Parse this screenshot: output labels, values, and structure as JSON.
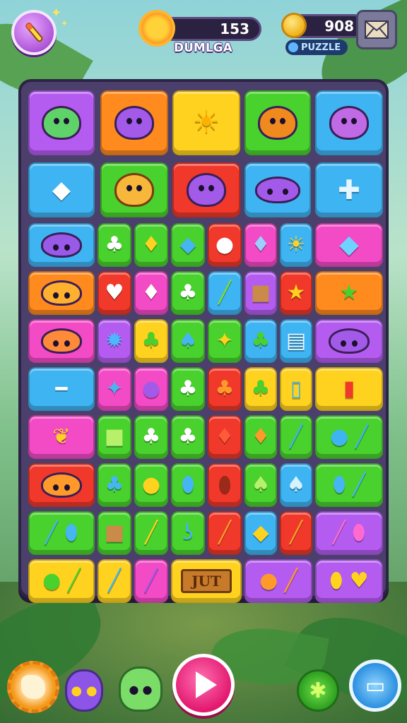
{
  "hud": {
    "score": "153",
    "title": "DUMLGA",
    "coins": "908",
    "mode": "PUZZLE"
  },
  "board": {
    "special_tile_label": "JUT",
    "rows": [
      [
        "purple-cat-face",
        "purple-cat-face",
        "sun-badge",
        "orange-sun-face",
        "purple-star-face"
      ],
      [
        "blue-lightning-gem",
        "orange-lion-face",
        "purple-cat-face",
        "purple-slime",
        "blue-shield-plus"
      ],
      [
        "purple-bat",
        "green-leaf",
        "yellow-bird",
        "blue-gem",
        "red-lollipop",
        "purple-crystal",
        "yellow-sun",
        "blue-gem"
      ],
      [
        "orange-crab",
        "red-heart",
        "pink-bottle",
        "green-leaf",
        "green-pencil",
        "brown-crate",
        "yellow-star",
        "green-star"
      ],
      [
        "orange-fox",
        "blue-spiky",
        "green-leaf",
        "blue-leaf",
        "yellow-star",
        "green-bush",
        "blue-chest",
        "purple-bug"
      ],
      [
        "blue-flute",
        "blue-star",
        "purple-bug",
        "green-leaf",
        "orange-leaf",
        "green-leaf",
        "blue-potion",
        "red-cup"
      ],
      [
        "yellow-coral",
        "green-book",
        "green-leaf",
        "green-leaf",
        "red-leaf",
        "orange-leaf",
        "blue-pencil",
        "green-pencil"
      ],
      [
        "orange-crab",
        "blue-leaf",
        "yellow-apple",
        "blue-drop",
        "red-seed",
        "green-leaf",
        "blue-leaf",
        "orange-pencil"
      ],
      [
        "green-pencil",
        "brown-chest",
        "yellow-pencil",
        "blue-hook",
        "orange-feather",
        "yellow-gem",
        "orange-feather",
        "pink-crayon"
      ],
      [
        "pink-crayon",
        "blue-pencil",
        "pink-pencil",
        "jut-sign",
        "orange-balloon",
        "pink-pencil",
        "orange-bean",
        "yellow-heart"
      ]
    ]
  },
  "colors": {
    "board": "#4b3f6b",
    "accent_play": "#e2186f"
  },
  "bottom": {
    "buttons": [
      "settings-gear",
      "purple-monster",
      "green-monster",
      "play",
      "star-boost",
      "book"
    ]
  }
}
